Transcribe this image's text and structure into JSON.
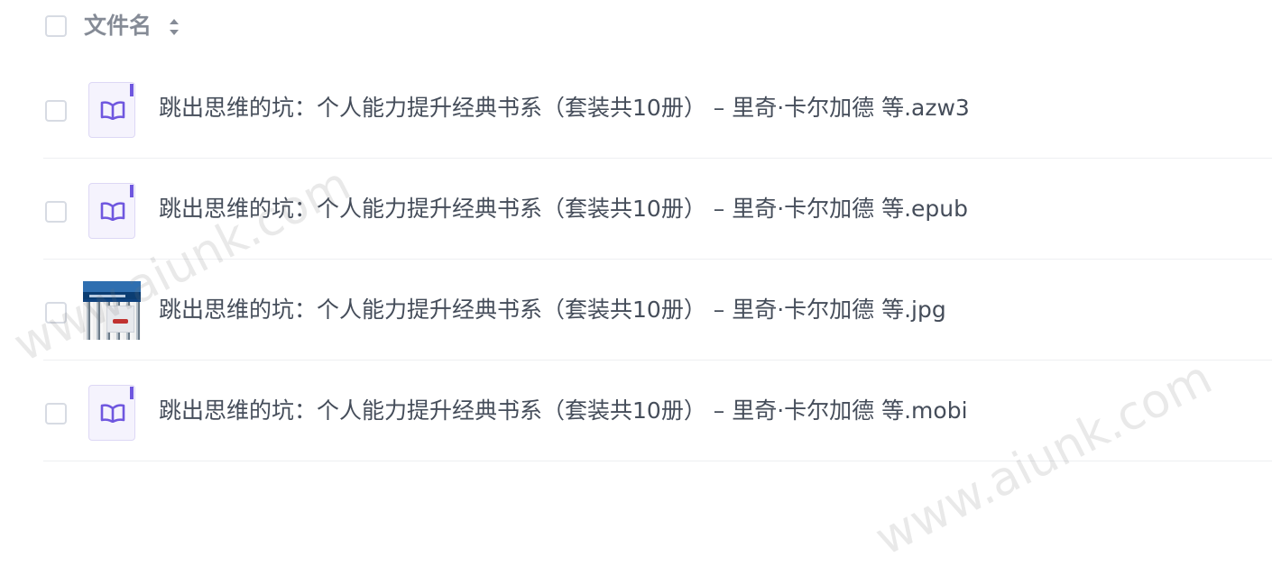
{
  "list_header": {
    "column_label": "文件名"
  },
  "files": [
    {
      "name": "跳出思维的坑：个人能力提升经典书系（套装共10册） – 里奇·卡尔加德 等.azw3",
      "icon": "ebook-icon"
    },
    {
      "name": "跳出思维的坑：个人能力提升经典书系（套装共10册） – 里奇·卡尔加德 等.epub",
      "icon": "ebook-icon"
    },
    {
      "name": "跳出思维的坑：个人能力提升经典书系（套装共10册） – 里奇·卡尔加德 等.jpg",
      "icon": "image-thumbnail"
    },
    {
      "name": "跳出思维的坑：个人能力提升经典书系（套装共10册） – 里奇·卡尔加德 等.mobi",
      "icon": "ebook-icon"
    }
  ],
  "watermarks": [
    "www.aiunk.com",
    "www.aiunk.com"
  ],
  "colors": {
    "text": "#454d5a",
    "header_text": "#858b96",
    "checkbox_border": "#d7dbe3",
    "divider": "#eeeff2",
    "ebook_accent": "#6f57df",
    "ebook_background": "#f5f3fd"
  }
}
